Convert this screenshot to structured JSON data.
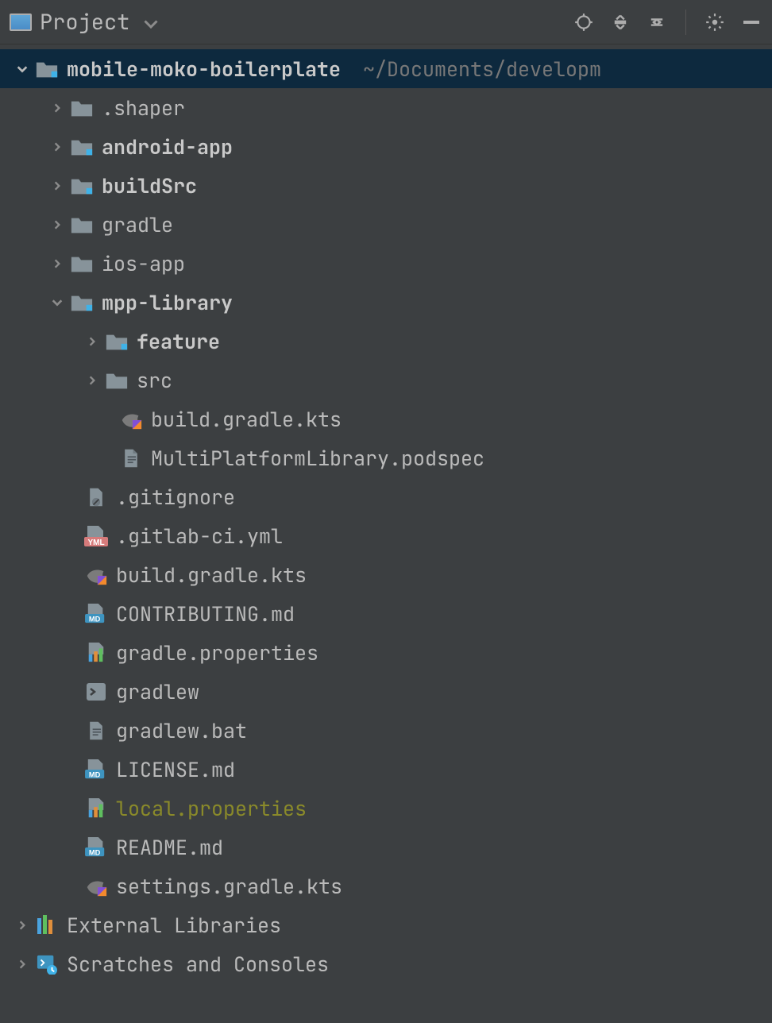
{
  "toolbar": {
    "view_label": "Project"
  },
  "tree": {
    "root": {
      "name": "mobile-moko-boilerplate",
      "path": "~/Documents/developm",
      "children": [
        {
          "name": ".shaper",
          "kind": "folder",
          "bold": false,
          "expanded": false
        },
        {
          "name": "android-app",
          "kind": "folder-module",
          "bold": true,
          "expanded": false
        },
        {
          "name": "buildSrc",
          "kind": "folder-module",
          "bold": true,
          "expanded": false
        },
        {
          "name": "gradle",
          "kind": "folder",
          "bold": false,
          "expanded": false
        },
        {
          "name": "ios-app",
          "kind": "folder",
          "bold": false,
          "expanded": false
        },
        {
          "name": "mpp-library",
          "kind": "folder-module",
          "bold": true,
          "expanded": true,
          "children": [
            {
              "name": "feature",
              "kind": "folder-module",
              "bold": true,
              "expanded": false
            },
            {
              "name": "src",
              "kind": "folder",
              "bold": false,
              "expanded": false
            },
            {
              "name": "build.gradle.kts",
              "kind": "gradle-kts"
            },
            {
              "name": "MultiPlatformLibrary.podspec",
              "kind": "text"
            }
          ]
        },
        {
          "name": ".gitignore",
          "kind": "gitignore"
        },
        {
          "name": ".gitlab-ci.yml",
          "kind": "yml"
        },
        {
          "name": "build.gradle.kts",
          "kind": "gradle-kts"
        },
        {
          "name": "CONTRIBUTING.md",
          "kind": "md"
        },
        {
          "name": "gradle.properties",
          "kind": "properties"
        },
        {
          "name": "gradlew",
          "kind": "shell"
        },
        {
          "name": "gradlew.bat",
          "kind": "text"
        },
        {
          "name": "LICENSE.md",
          "kind": "md"
        },
        {
          "name": "local.properties",
          "kind": "properties",
          "olive": true
        },
        {
          "name": "README.md",
          "kind": "md"
        },
        {
          "name": "settings.gradle.kts",
          "kind": "gradle-kts"
        }
      ]
    },
    "extra": [
      {
        "name": "External Libraries",
        "kind": "ext-lib"
      },
      {
        "name": "Scratches and Consoles",
        "kind": "scratch"
      }
    ]
  }
}
